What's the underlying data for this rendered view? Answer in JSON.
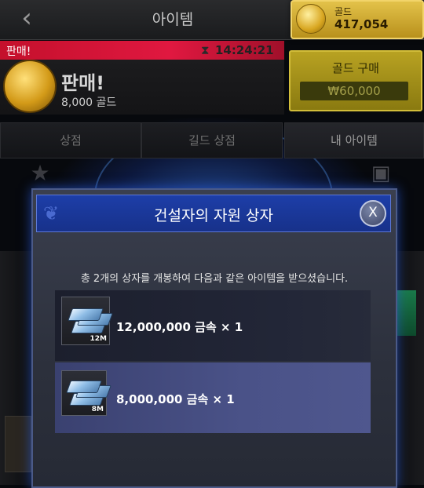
{
  "header": {
    "back_icon": "chevron-left-icon",
    "title": "아이템",
    "gold": {
      "label": "골드",
      "value": "417,054",
      "icon": "gold-coin-icon"
    }
  },
  "sale": {
    "strip_label": "판매!",
    "timer": "14:24:21",
    "timer_icon": "hourglass-icon",
    "title": "판매!",
    "price": "8,000 골드"
  },
  "buy_gold": {
    "label": "골드 구매",
    "price": "₩60,000"
  },
  "tabs": [
    {
      "label": "상점"
    },
    {
      "label": "길드 상점"
    },
    {
      "label": "내 아이템"
    }
  ],
  "modal": {
    "title": "건설자의 자원 상자",
    "close_label": "X",
    "message": "총 2개의 상자를 개봉하여 다음과 같은 아이템을 받으셨습니다.",
    "rewards": [
      {
        "qty_tag": "12M",
        "text": "12,000,000 금속 × 1",
        "icon": "metal-ingot-icon"
      },
      {
        "qty_tag": "8M",
        "text": "8,000,000 금속 × 1",
        "icon": "metal-ingot-icon"
      }
    ]
  },
  "colors": {
    "modal_header": "#1d3ea8",
    "gold_accent": "#e3c24a",
    "sale_red": "#e01840",
    "highlight_row": "#4a5288"
  }
}
